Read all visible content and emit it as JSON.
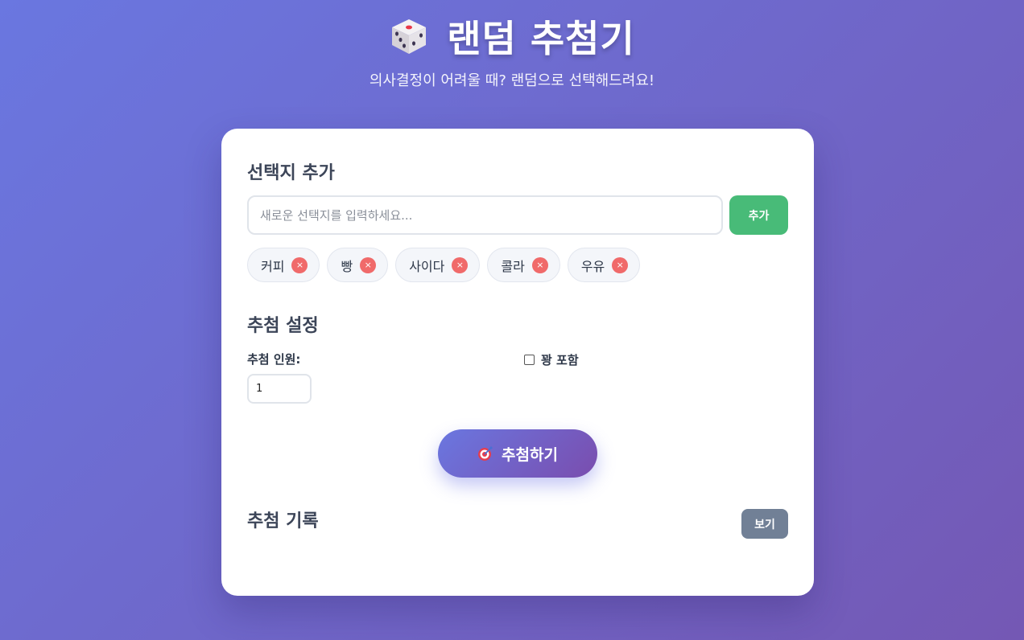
{
  "header": {
    "icon": "dice-icon",
    "title": "랜덤 추첨기",
    "subtitle": "의사결정이 어려울 때? 랜덤으로 선택해드려요!"
  },
  "add_section": {
    "title": "선택지 추가",
    "input_placeholder": "새로운 선택지를 입력하세요...",
    "input_value": "",
    "add_button_label": "추가",
    "remove_icon": "close-icon",
    "remove_glyph": "×",
    "choices": [
      "커피",
      "빵",
      "사이다",
      "콜라",
      "우유"
    ]
  },
  "settings": {
    "title": "추첨 설정",
    "count_label": "추첨 인원:",
    "count_value": "1",
    "include_blank_label": "꽝 포함",
    "include_blank_checked": false
  },
  "draw_button": {
    "icon": "target-icon",
    "label": "추첨하기"
  },
  "history": {
    "title": "추첨 기록",
    "view_button_label": "보기"
  },
  "colors": {
    "background_start": "#6a77e0",
    "background_end": "#7458b4",
    "add_button": "#48bb78",
    "remove_icon": "#f06a6a",
    "view_button": "#718096",
    "heading_text": "#3c4558"
  }
}
